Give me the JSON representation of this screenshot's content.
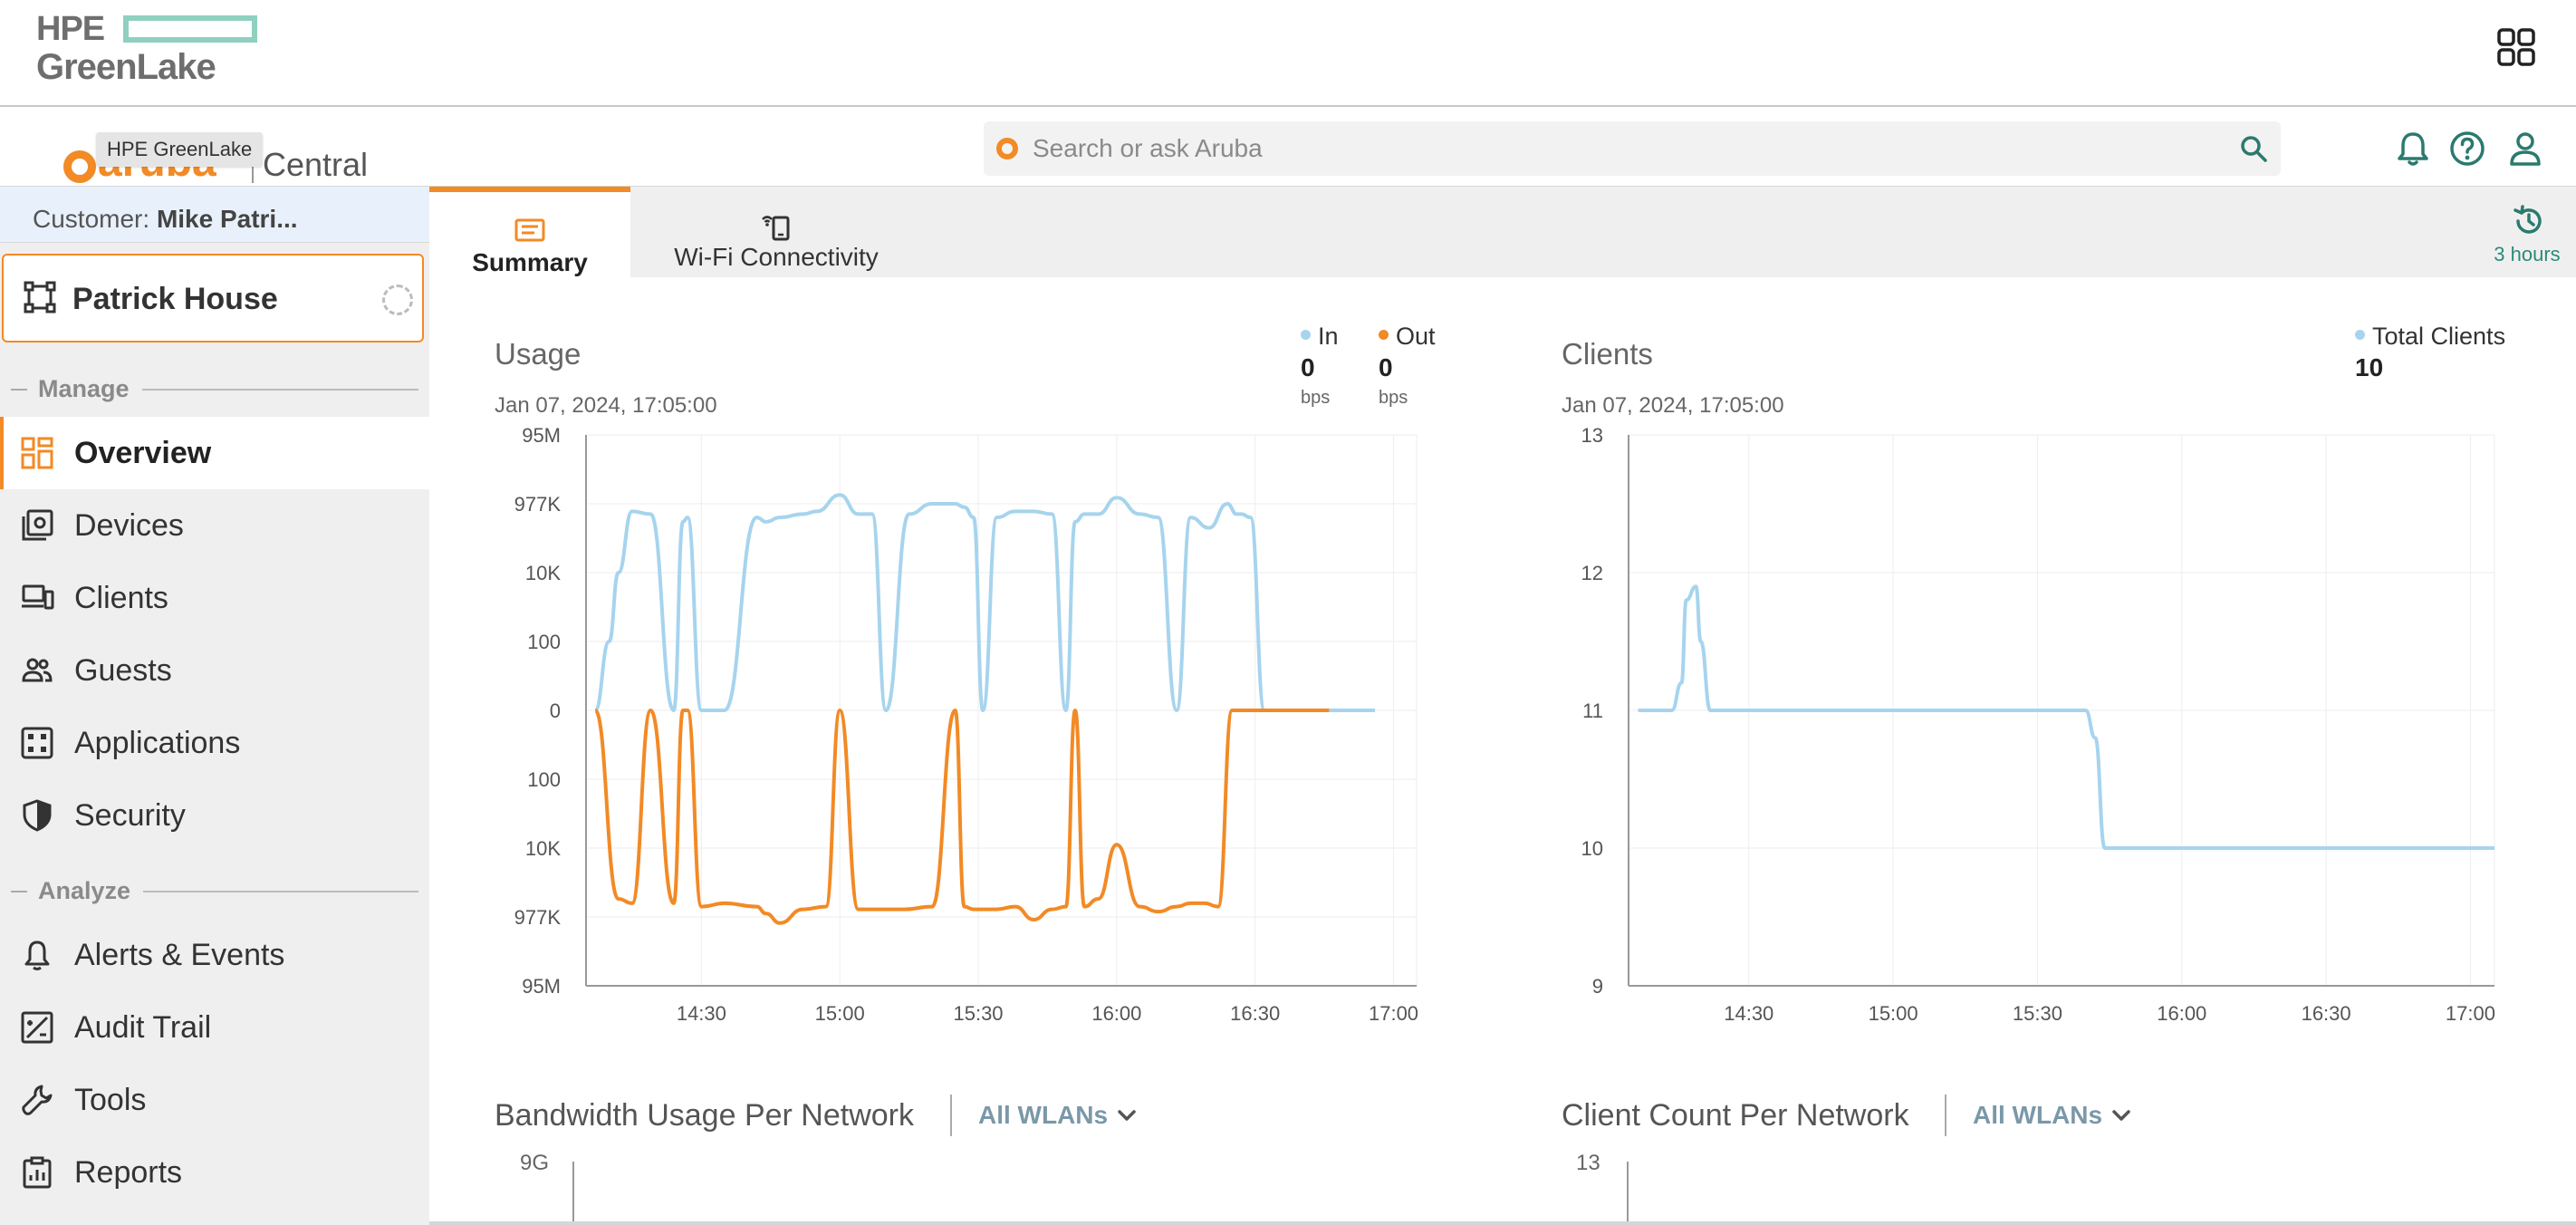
{
  "header": {
    "hpe_text": "HPE",
    "greenlake_text": "GreenLake",
    "aruba_word": "aruba",
    "central_text": "Central",
    "tooltip": "HPE GreenLake",
    "search_placeholder": "Search or ask Aruba",
    "brand_color": "#f28a25",
    "teal_color": "#2a7a6e"
  },
  "sidebar": {
    "customer_label": "Customer:",
    "customer_name": "Mike Patri...",
    "site_name": "Patrick House",
    "sections": {
      "manage": "Manage",
      "analyze": "Analyze"
    },
    "items": [
      {
        "label": "Overview",
        "icon": "overview-grid-icon",
        "active": true
      },
      {
        "label": "Devices",
        "icon": "devices-icon"
      },
      {
        "label": "Clients",
        "icon": "clients-icon"
      },
      {
        "label": "Guests",
        "icon": "guests-icon"
      },
      {
        "label": "Applications",
        "icon": "applications-icon"
      },
      {
        "label": "Security",
        "icon": "shield-icon"
      },
      {
        "label": "Alerts & Events",
        "icon": "bell-icon"
      },
      {
        "label": "Audit Trail",
        "icon": "audit-trail-icon"
      },
      {
        "label": "Tools",
        "icon": "wrench-icon"
      },
      {
        "label": "Reports",
        "icon": "reports-icon"
      }
    ]
  },
  "tabs": [
    {
      "label": "Summary",
      "active": true
    },
    {
      "label": "Wi-Fi Connectivity"
    }
  ],
  "time_range": "3 hours",
  "usage": {
    "title": "Usage",
    "timestamp": "Jan 07, 2024, 17:05:00",
    "legend": [
      {
        "name": "In",
        "value": "0",
        "unit": "bps",
        "color": "#a6d4ee"
      },
      {
        "name": "Out",
        "value": "0",
        "unit": "bps",
        "color": "#f28a25"
      }
    ]
  },
  "clients": {
    "title": "Clients",
    "timestamp": "Jan 07, 2024, 17:05:00",
    "legend": [
      {
        "name": "Total Clients",
        "value": "10",
        "color": "#a6d4ee"
      }
    ]
  },
  "bandwidth": {
    "title": "Bandwidth Usage Per Network",
    "dropdown": "All WLANs",
    "y_top": "9G"
  },
  "client_count": {
    "title": "Client Count Per Network",
    "dropdown": "All WLANs",
    "y_top": "13"
  },
  "chart_data": [
    {
      "type": "line",
      "title": "Usage",
      "y_scale": "symmetric log",
      "y_ticks": [
        "95M",
        "977K",
        "10K",
        "100",
        "0",
        "100",
        "10K",
        "977K",
        "95M"
      ],
      "x_ticks": [
        "14:30",
        "15:00",
        "15:30",
        "16:00",
        "16:30",
        "17:00"
      ],
      "xlim": [
        "14:05",
        "17:05"
      ],
      "grid": true,
      "series": [
        {
          "name": "In",
          "color": "#a6d4ee",
          "x": [
            "14:07",
            "14:10",
            "14:12",
            "14:15",
            "14:19",
            "14:24",
            "14:26",
            "14:27",
            "14:30",
            "14:35",
            "14:42",
            "14:44",
            "14:47",
            "14:52",
            "14:55",
            "15:00",
            "15:04",
            "15:07",
            "15:10",
            "15:15",
            "15:20",
            "15:25",
            "15:27",
            "15:29",
            "15:31",
            "15:34",
            "15:38",
            "15:42",
            "15:46",
            "15:49",
            "15:51",
            "15:53",
            "15:56",
            "16:00",
            "16:05",
            "16:09",
            "16:13",
            "16:16",
            "16:20",
            "16:24",
            "16:26",
            "16:27",
            "16:29",
            "16:32",
            "16:34",
            "16:37",
            "16:40",
            "16:44",
            "16:48",
            "16:53",
            "16:56"
          ],
          "y": [
            0,
            100.0,
            10000.0,
            600000.0,
            500000.0,
            0,
            300000.0,
            400000.0,
            0,
            0,
            400000.0,
            300000.0,
            400000.0,
            500000.0,
            600000.0,
            1800000.0,
            500000.0,
            500000.0,
            0,
            500000.0,
            1000000.0,
            1000000.0,
            800000.0,
            400000.0,
            0,
            400000.0,
            600000.0,
            600000.0,
            500000.0,
            0,
            300000.0,
            500000.0,
            500000.0,
            1500000.0,
            500000.0,
            400000.0,
            0,
            400000.0,
            200000.0,
            1000000.0,
            500000.0,
            500000.0,
            400000.0,
            0,
            0,
            0,
            0,
            0,
            0,
            0,
            0
          ]
        },
        {
          "name": "Out",
          "color": "#f28a25",
          "x": [
            "14:07",
            "14:12",
            "14:15",
            "14:19",
            "14:24",
            "14:26",
            "14:27",
            "14:30",
            "14:35",
            "14:42",
            "14:44",
            "14:47",
            "14:52",
            "14:57",
            "15:00",
            "15:04",
            "15:07",
            "15:10",
            "15:14",
            "15:20",
            "15:25",
            "15:27",
            "15:29",
            "15:31",
            "15:34",
            "15:38",
            "15:42",
            "15:46",
            "15:49",
            "15:51",
            "15:53",
            "15:56",
            "16:00",
            "16:05",
            "16:09",
            "16:13",
            "16:16",
            "16:19",
            "16:22",
            "16:25",
            "16:27",
            "16:29",
            "16:32",
            "16:34",
            "16:38",
            "16:42",
            "16:44",
            "16:46"
          ],
          "y": [
            0,
            300000.0,
            400000.0,
            0,
            400000.0,
            0,
            0,
            500000.0,
            400000.0,
            500000.0,
            800000.0,
            1500000.0,
            600000.0,
            500000.0,
            0,
            600000.0,
            600000.0,
            600000.0,
            600000.0,
            500000.0,
            0,
            500000.0,
            600000.0,
            600000.0,
            600000.0,
            500000.0,
            1200000.0,
            600000.0,
            500000.0,
            0,
            500000.0,
            300000.0,
            8000.0,
            500000.0,
            700000.0,
            500000.0,
            400000.0,
            400000.0,
            500000.0,
            0,
            0,
            0,
            0,
            0,
            0,
            0,
            0,
            0
          ]
        }
      ]
    },
    {
      "type": "line",
      "title": "Clients",
      "ylim": [
        9,
        13
      ],
      "y_ticks": [
        9,
        10,
        11,
        12,
        13
      ],
      "x_ticks": [
        "14:30",
        "15:00",
        "15:30",
        "16:00",
        "16:30",
        "17:00"
      ],
      "xlim": [
        "14:05",
        "17:05"
      ],
      "grid": true,
      "series": [
        {
          "name": "Total Clients",
          "color": "#a6d4ee",
          "x": [
            "14:07",
            "14:14",
            "14:16",
            "14:17",
            "14:19",
            "14:20",
            "14:22",
            "14:23",
            "15:40",
            "15:42",
            "15:44",
            "17:05"
          ],
          "y": [
            11,
            11,
            11.2,
            11.8,
            11.9,
            11.5,
            11,
            11,
            11,
            10.8,
            10,
            10
          ]
        }
      ]
    }
  ]
}
